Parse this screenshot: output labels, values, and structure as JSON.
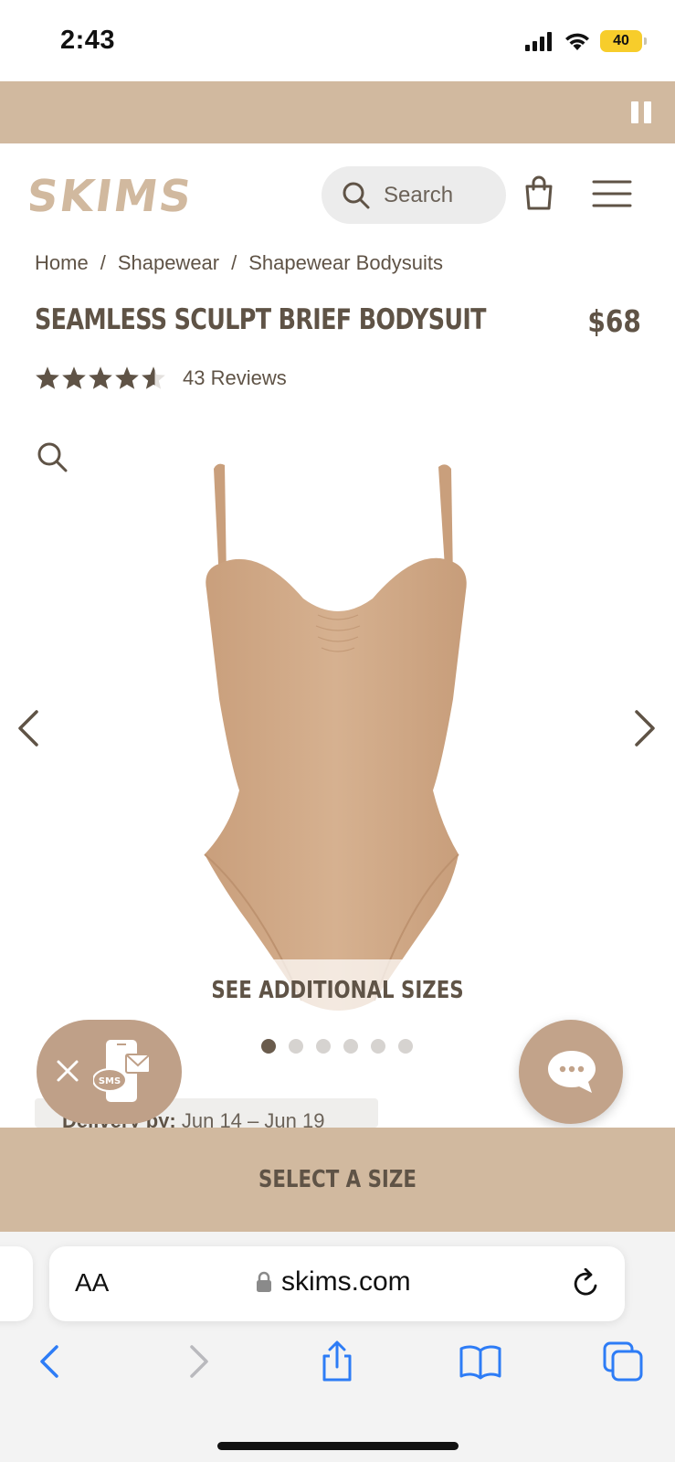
{
  "status_bar": {
    "time": "2:43",
    "battery": "40"
  },
  "header": {
    "logo_text": "SKIMS",
    "search_placeholder": "Search"
  },
  "breadcrumb": {
    "items": [
      "Home",
      "Shapewear",
      "Shapewear Bodysuits"
    ],
    "separator": "/"
  },
  "product": {
    "title": "SEAMLESS SCULPT BRIEF BODYSUIT",
    "price": "$68",
    "rating_value": 4.5,
    "rating_max": 5,
    "reviews_label": "43 Reviews",
    "image_color": "#d2ad8b"
  },
  "gallery": {
    "sizes_label": "SEE ADDITIONAL SIZES",
    "dot_count": 6,
    "active_dot": 0
  },
  "delivery": {
    "label": "Delivery by:",
    "dates": "Jun 14 – Jun 19"
  },
  "cta": {
    "select_size": "SELECT A SIZE"
  },
  "sms_widget": {
    "badge": "SMS"
  },
  "browser": {
    "text_size": "AA",
    "url": "skims.com"
  },
  "colors": {
    "accent": "#d1b99f",
    "text": "#5f5346",
    "safari_blue": "#2d7cf6"
  }
}
